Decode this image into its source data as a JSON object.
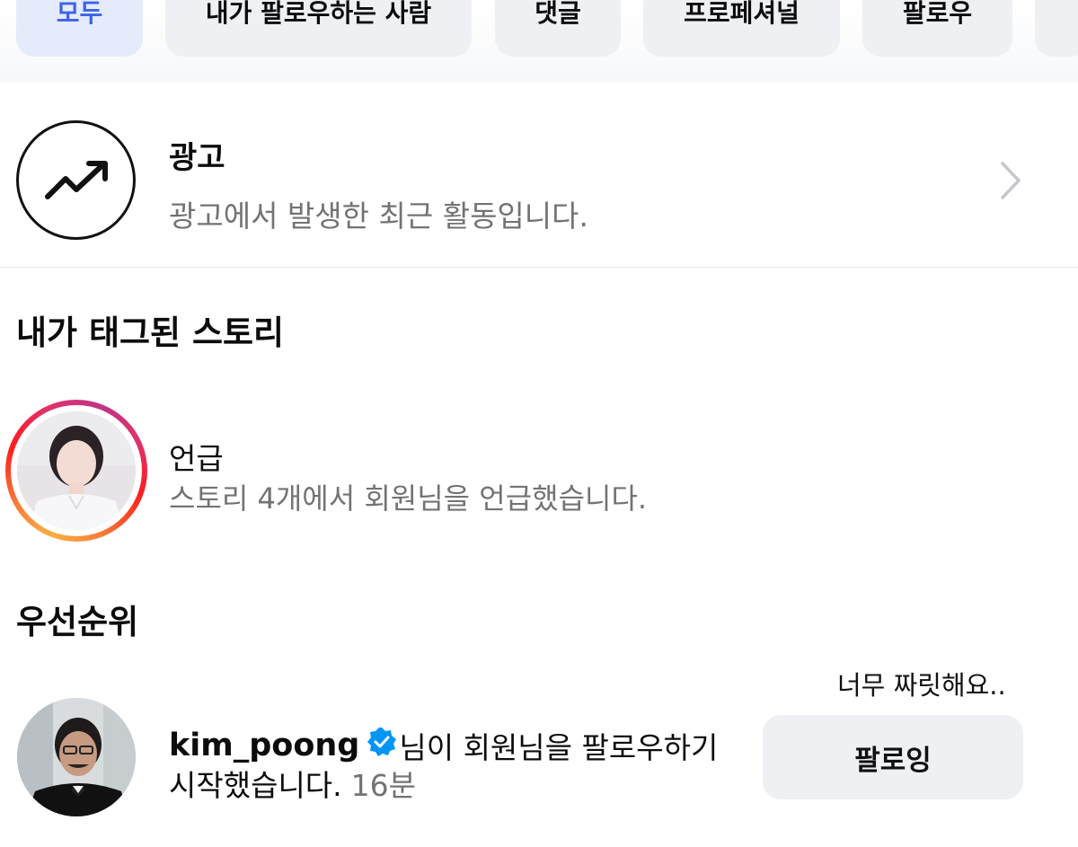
{
  "filters": [
    {
      "label": "모두",
      "active": true
    },
    {
      "label": "내가 팔로우하는 사람",
      "active": false
    },
    {
      "label": "댓글",
      "active": false
    },
    {
      "label": "프로페셔널",
      "active": false
    },
    {
      "label": "팔로우",
      "active": false
    }
  ],
  "ads": {
    "title": "광고",
    "subtitle": "광고에서 발생한 최근 활동입니다.",
    "icon": "trending-up-icon"
  },
  "tagged_stories": {
    "heading": "내가 태그된 스토리",
    "item": {
      "title": "언급",
      "subtitle": "스토리 4개에서 회원님을 언급했습니다."
    }
  },
  "priority": {
    "heading": "우선순위",
    "note": "너무 짜릿해요..",
    "notification": {
      "username": "kim_poong",
      "message": "님이 회원님을 팔로우하기",
      "message_cont": "시작했습니다.",
      "time": "16분",
      "button_label": "팔로잉"
    }
  },
  "colors": {
    "accent": "#3d64e8",
    "chip_bg": "#eef0f3",
    "verified": "#0095f6",
    "secondary_text": "#737373"
  }
}
